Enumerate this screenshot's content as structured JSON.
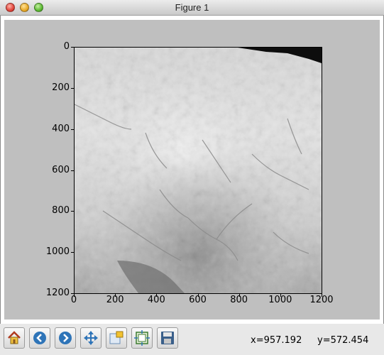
{
  "window": {
    "title": "Figure 1",
    "controls": [
      "close",
      "minimize",
      "zoom"
    ]
  },
  "chart_data": {
    "type": "heatmap",
    "description_colormap": "gray",
    "xlim": [
      0,
      1200
    ],
    "ylim": [
      1200,
      0
    ],
    "xticks": [
      "0",
      "200",
      "400",
      "600",
      "800",
      "1000",
      "1200"
    ],
    "yticks": [
      "0",
      "200",
      "400",
      "600",
      "800",
      "1000",
      "1200"
    ],
    "title": "",
    "xlabel": "",
    "ylabel": ""
  },
  "toolbar": {
    "buttons": [
      {
        "name": "home-icon",
        "label": "Home"
      },
      {
        "name": "back-icon",
        "label": "Back"
      },
      {
        "name": "forward-icon",
        "label": "Forward"
      },
      {
        "name": "pan-icon",
        "label": "Pan"
      },
      {
        "name": "zoom-icon",
        "label": "Zoom"
      },
      {
        "name": "subplots-icon",
        "label": "Subplots"
      },
      {
        "name": "save-icon",
        "label": "Save"
      }
    ]
  },
  "status": {
    "x_readout": "x=957.192",
    "y_readout": "y=572.454"
  },
  "colors": {
    "canvas_bg": "#bfbfbf",
    "accent_blue": "#2e74b8"
  }
}
